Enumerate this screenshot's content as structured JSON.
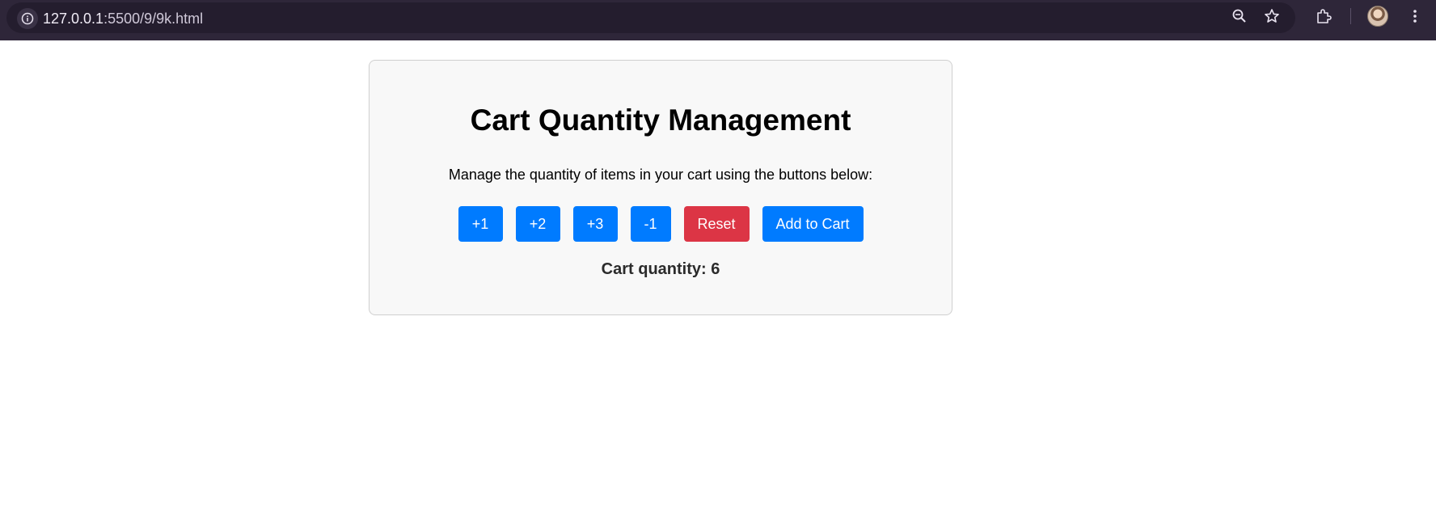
{
  "browser": {
    "url_host": "127.0.0.1",
    "url_rest": ":5500/9/9k.html",
    "icons": {
      "site_info": "info-icon",
      "zoom": "zoom-out-icon",
      "bookmark": "star-icon",
      "extensions": "puzzle-icon",
      "profile": "avatar",
      "menu": "kebab-menu-icon"
    },
    "colors": {
      "topbar": "#2e2639",
      "omnibox": "#241d2e"
    }
  },
  "page": {
    "title": "Cart Quantity Management",
    "description": "Manage the quantity of items in your cart using the buttons below:",
    "buttons": {
      "plus1": "+1",
      "plus2": "+2",
      "plus3": "+3",
      "minus1": "-1",
      "reset": "Reset",
      "add_to_cart": "Add to Cart"
    },
    "quantity_label": "Cart quantity: 6",
    "colors": {
      "primary": "#007bff",
      "danger": "#dc3545",
      "card_background": "#f8f8f8"
    }
  }
}
